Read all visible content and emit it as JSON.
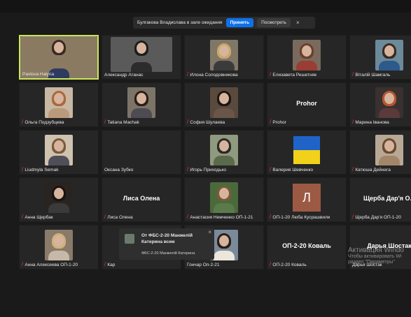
{
  "waiting_room": {
    "message": "Булгакова Владислава в зале ожидания",
    "admit_label": "Принять",
    "view_label": "Посмотреть",
    "close_glyph": "×"
  },
  "participants": [
    {
      "name": "Pavlova Halyna",
      "muted": false,
      "kind": "photo",
      "active": true,
      "colors": [
        "#8a7a62",
        "#3b2a22",
        "#2e3b5e"
      ]
    },
    {
      "name": "Александр Атанас",
      "muted": false,
      "kind": "photo",
      "colors": [
        "#5a5a5a",
        "#1d1d1d",
        "#2c2c2c"
      ]
    },
    {
      "name": "Илона Солодовникова",
      "muted": true,
      "kind": "photo",
      "colors": [
        "#807766",
        "#c9a86a",
        "#3b3b3b"
      ]
    },
    {
      "name": "Елизавета Решетняк",
      "muted": true,
      "kind": "photo",
      "colors": [
        "#7a6a5e",
        "#6b3f2a",
        "#9a3d34"
      ]
    },
    {
      "name": "Віталій Шамгаль",
      "muted": true,
      "kind": "photo",
      "colors": [
        "#6b8a9a",
        "#3a2a20",
        "#2d5a8c"
      ]
    },
    {
      "name": "Ольга Подзубцева",
      "muted": true,
      "kind": "photo",
      "colors": [
        "#c8b7a3",
        "#a9683c",
        "#b99a7a"
      ]
    },
    {
      "name": "Tatiana Machak",
      "muted": true,
      "kind": "photo",
      "colors": [
        "#7d7468",
        "#2a1e18",
        "#4c4c52"
      ]
    },
    {
      "name": "София Шулаева",
      "muted": true,
      "kind": "photo",
      "colors": [
        "#5a4a3e",
        "#1e1612",
        "#6a5548"
      ]
    },
    {
      "name": "Prohor",
      "muted": true,
      "kind": "text",
      "big": "Prohor"
    },
    {
      "name": "Марина Іванова",
      "muted": true,
      "kind": "photo",
      "colors": [
        "#3a3030",
        "#b5562e",
        "#5a3a3a"
      ]
    },
    {
      "name": "Liudmyla Semak",
      "muted": true,
      "kind": "photo",
      "colors": [
        "#cfc2ae",
        "#7b5a3a",
        "#4f4f5a"
      ]
    },
    {
      "name": "Оксана Зубко",
      "muted": false,
      "kind": "blank"
    },
    {
      "name": "Игорь Приходько",
      "muted": true,
      "kind": "photo",
      "colors": [
        "#8f9a7e",
        "#2a2a2a",
        "#5a6a4a"
      ]
    },
    {
      "name": "Валерия Шевченко",
      "muted": true,
      "kind": "flag"
    },
    {
      "name": "Катюша Дейнега",
      "muted": true,
      "kind": "photo",
      "colors": [
        "#b8a895",
        "#6a4a2e",
        "#a3866a"
      ]
    },
    {
      "name": "Анна Щербак",
      "muted": true,
      "kind": "photo",
      "colors": [
        "#2a2420",
        "#1a1410",
        "#3a3a3a"
      ]
    },
    {
      "name": "Лиса Олена",
      "muted": true,
      "kind": "text",
      "big": "Лиса Олена"
    },
    {
      "name": "Анастасия Немченко ОП-1-21",
      "muted": true,
      "kind": "photo",
      "colors": [
        "#4a6a3a",
        "#7a5a3a",
        "#5a7a4a"
      ]
    },
    {
      "name": "ОП-1-20 Люба Кусрашвили",
      "muted": true,
      "kind": "letter",
      "letter": "Л"
    },
    {
      "name": "Щерба Дар'я ОП-1-20",
      "muted": true,
      "kind": "text",
      "big": "Щерба Дар'я О..."
    },
    {
      "name": "Анна Алексеева ОП-1-20",
      "muted": true,
      "kind": "photo",
      "colors": [
        "#8a7a6a",
        "#d0b27a",
        "#c7b9a8"
      ]
    },
    {
      "name": "Кар",
      "muted": true,
      "kind": "blank"
    },
    {
      "name": "Гончар Оп-2-21",
      "muted": false,
      "kind": "photo",
      "colors": [
        "#7a8a9a",
        "#2a1e16",
        "#ece6dc"
      ]
    },
    {
      "name": "ОП-2-20 Коваль",
      "muted": true,
      "kind": "text",
      "big": "ОП-2-20 Коваль"
    },
    {
      "name": "Дарья Шостак",
      "muted": false,
      "kind": "text",
      "big": "Дарья Шостак"
    }
  ],
  "chat_popup": {
    "from": "От ФБС-2-20 Манжелій Катерина всем",
    "message": "ФБС-2-20 Манжелій Катерина",
    "close_glyph": "×"
  },
  "watermark": {
    "line1": "Активация Windo",
    "line2": "Чтобы активировать Wi",
    "line3": "раздел \"Параметры\""
  }
}
